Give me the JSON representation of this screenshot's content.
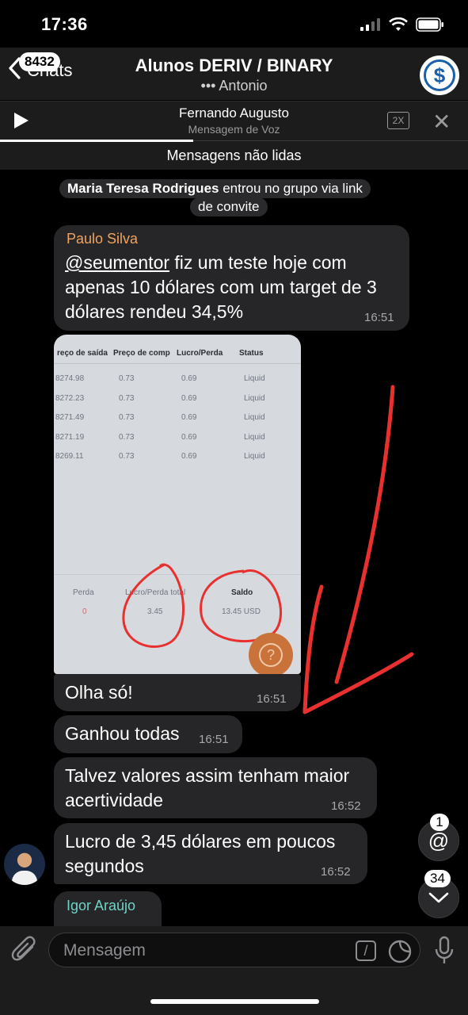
{
  "status": {
    "time": "17:36"
  },
  "header": {
    "back_label": "Chats",
    "unread_count": "8432",
    "title": "Alunos DERIV / BINARY",
    "subtitle": "••• Antonio"
  },
  "player": {
    "name": "Fernando Augusto",
    "type": "Mensagem de Voz",
    "speed": "2X"
  },
  "divider": {
    "unread_label": "Mensagens não lidas"
  },
  "service": {
    "user": "Maria Teresa Rodrigues",
    "text_1": " entrou no grupo via link",
    "text_2": "de convite"
  },
  "messages": {
    "m1": {
      "sender": "Paulo Silva",
      "mention": "@seumentor",
      "text_a": " fiz um teste hoje com",
      "text_b": "apenas 10 dólares com um target de 3",
      "text_c": "dólares rendeu 34,5%",
      "time": "16:51"
    },
    "photo": {
      "headers": [
        "reço de saída",
        "Preço de comp",
        "Lucro/Perda",
        "Status"
      ],
      "rows": [
        [
          "8274.98",
          "0.73",
          "0.69",
          "Liquid"
        ],
        [
          "8272.23",
          "0.73",
          "0.69",
          "Liquid"
        ],
        [
          "8271.49",
          "0.73",
          "0.69",
          "Liquid"
        ],
        [
          "8271.19",
          "0.73",
          "0.69",
          "Liquid"
        ],
        [
          "8269.11",
          "0.73",
          "0.69",
          "Liquid"
        ]
      ],
      "summary_labels": [
        "Perda",
        "Lucro/Perda total",
        "Saldo"
      ],
      "summary_values": [
        "0",
        "3.45",
        "13.45 USD"
      ],
      "help": "?"
    },
    "m2": {
      "text": "Olha só!",
      "time": "16:51"
    },
    "m3": {
      "text": "Ganhou todas",
      "time": "16:51"
    },
    "m4": {
      "text_a": "Talvez valores assim tenham maior",
      "text_b": "acertividade",
      "time": "16:52"
    },
    "m5": {
      "text_a": "Lucro de 3,45 dólares em poucos",
      "text_b": "segundos",
      "time": "16:52"
    },
    "m6": {
      "sender": "Igor Araújo"
    }
  },
  "fabs": {
    "mentions_count": "1",
    "down_count": "34"
  },
  "input": {
    "placeholder": "Mensagem"
  },
  "colors": {
    "sender_paulo": "#f0a35e",
    "sender_igor": "#6fd3c6",
    "annotation_red": "#e8312f"
  }
}
